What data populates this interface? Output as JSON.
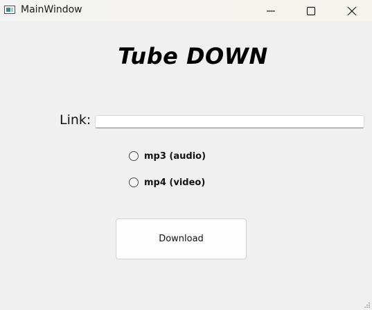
{
  "window": {
    "title": "MainWindow",
    "icon": "app-window-icon",
    "controls": {
      "minimize_icon": "minimize-icon",
      "maximize_icon": "maximize-icon",
      "close_icon": "close-icon"
    }
  },
  "main": {
    "app_title": "Tube DOWN",
    "link_label": "Link:",
    "link_value": "",
    "options": [
      {
        "label": "mp3 (audio)",
        "checked": false
      },
      {
        "label": "mp4 (video)",
        "checked": false
      }
    ],
    "download_label": "Download"
  },
  "colors": {
    "background": "#f0f0f0",
    "titlebar": "#f3f3f3",
    "button_bg": "#fdfdfd"
  }
}
